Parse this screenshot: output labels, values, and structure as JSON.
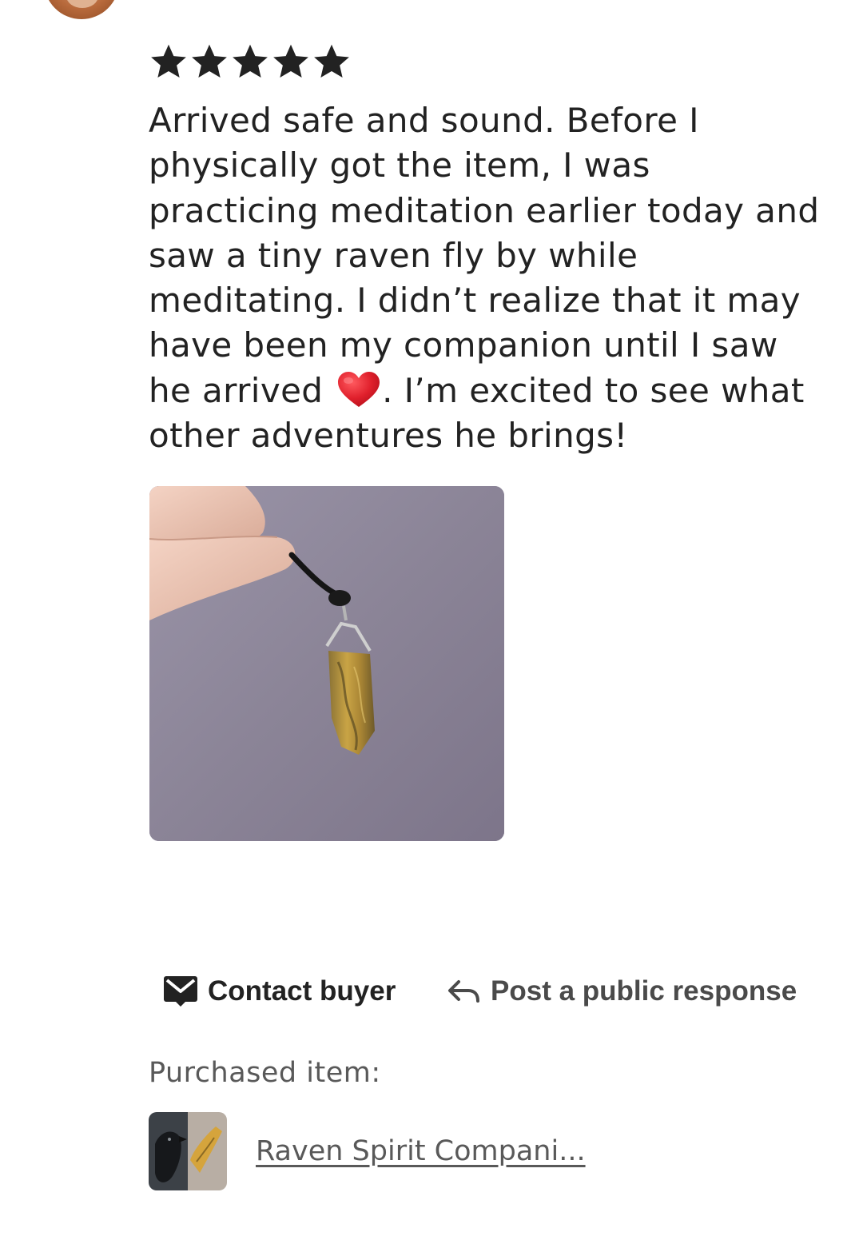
{
  "review": {
    "rating": 5,
    "rating_max": 5,
    "text_part1": "Arrived safe and sound. Before I physically got the item, I was practicing meditation earlier today and saw a tiny raven fly by while meditating. I didn’t realize that it may have been my companion until I saw he arrived ",
    "emoji": "red-heart-emoji",
    "text_part2": ". I’m excited to see what other adventures he brings!"
  },
  "actions": {
    "contact_buyer_label": "Contact buyer",
    "contact_icon": "envelope-icon",
    "public_response_label": "Post a public response",
    "public_response_icon": "reply-arrow-icon"
  },
  "purchase": {
    "label": "Purchased item:",
    "item_title": "Raven Spirit Compani..."
  },
  "colors": {
    "text": "#222222",
    "muted": "#595959",
    "star": "#222222",
    "heart": "#e0202c"
  }
}
